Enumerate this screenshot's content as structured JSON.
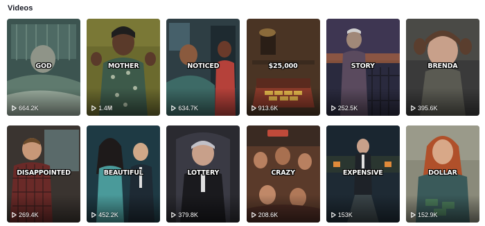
{
  "section": {
    "title": "Videos"
  },
  "videos": [
    {
      "caption": "GOD",
      "views": "664.2K",
      "colors": {
        "bg": "#3c5450",
        "mid": "#5f7a6e",
        "accent": "#c8d4c4",
        "skin": "#8f9488"
      },
      "subject": "old man lying in hospital bed"
    },
    {
      "caption": "MOTHER",
      "views": "1.4M",
      "colors": {
        "bg": "#6b6a2e",
        "mid": "#3d5a4a",
        "accent": "#a9b6a0",
        "skin": "#5a3a2a"
      },
      "subject": "angry woman in floral dress"
    },
    {
      "caption": "NOTICED",
      "views": "634.7K",
      "colors": {
        "bg": "#2e3e44",
        "mid": "#3d6a66",
        "accent": "#b5413a",
        "skin": "#8a5a3e"
      },
      "subject": "man in bed and woman in doorway"
    },
    {
      "caption": "$25,000",
      "views": "913.6K",
      "colors": {
        "bg": "#4a3424",
        "mid": "#6e4a2a",
        "accent": "#e0b44a",
        "skin": "#8a3a2a"
      },
      "subject": "chest of gold bars"
    },
    {
      "caption": "STORY",
      "views": "252.5K",
      "colors": {
        "bg": "#2a2a3e",
        "mid": "#5a4a5e",
        "accent": "#c06a3a",
        "skin": "#a08878"
      },
      "subject": "old man standing at gate at dusk"
    },
    {
      "caption": "BRENDA",
      "views": "395.6K",
      "colors": {
        "bg": "#3a3a3a",
        "mid": "#5a5a52",
        "accent": "#8a7a6a",
        "skin": "#c8a08a"
      },
      "subject": "sad girl with pigtails"
    },
    {
      "caption": "DISAPPOINTED",
      "views": "269.4K",
      "colors": {
        "bg": "#3a3430",
        "mid": "#6a2a28",
        "accent": "#a8b6b4",
        "skin": "#c89878"
      },
      "subject": "man in plaid shirt"
    },
    {
      "caption": "BEAUTIFUL",
      "views": "452.2K",
      "colors": {
        "bg": "#1e3a44",
        "mid": "#2e5a5a",
        "accent": "#4a9a9a",
        "skin": "#8a5a3e"
      },
      "subject": "woman and man in suit"
    },
    {
      "caption": "LOTTERY",
      "views": "379.8K",
      "colors": {
        "bg": "#2a2a30",
        "mid": "#3a3a44",
        "accent": "#c0c0c8",
        "skin": "#c8a08a"
      },
      "subject": "old man in dark chair"
    },
    {
      "caption": "CRAZY",
      "views": "208.6K",
      "colors": {
        "bg": "#5a3a2a",
        "mid": "#7a4a34",
        "accent": "#c04a3a",
        "skin": "#b88060"
      },
      "subject": "crowd in diner"
    },
    {
      "caption": "EXPENSIVE",
      "views": "153K",
      "colors": {
        "bg": "#1e2a34",
        "mid": "#2a3a3e",
        "accent": "#e08a3a",
        "skin": "#c8a08a"
      },
      "subject": "man in suit on driveway at night"
    },
    {
      "caption": "DOLLAR",
      "views": "152.9K",
      "colors": {
        "bg": "#8a8a7a",
        "mid": "#3a5a5a",
        "accent": "#4a7a5a",
        "skin": "#d8a888"
      },
      "subject": "red haired woman holding money"
    }
  ],
  "icons": {
    "play": "play-icon"
  }
}
